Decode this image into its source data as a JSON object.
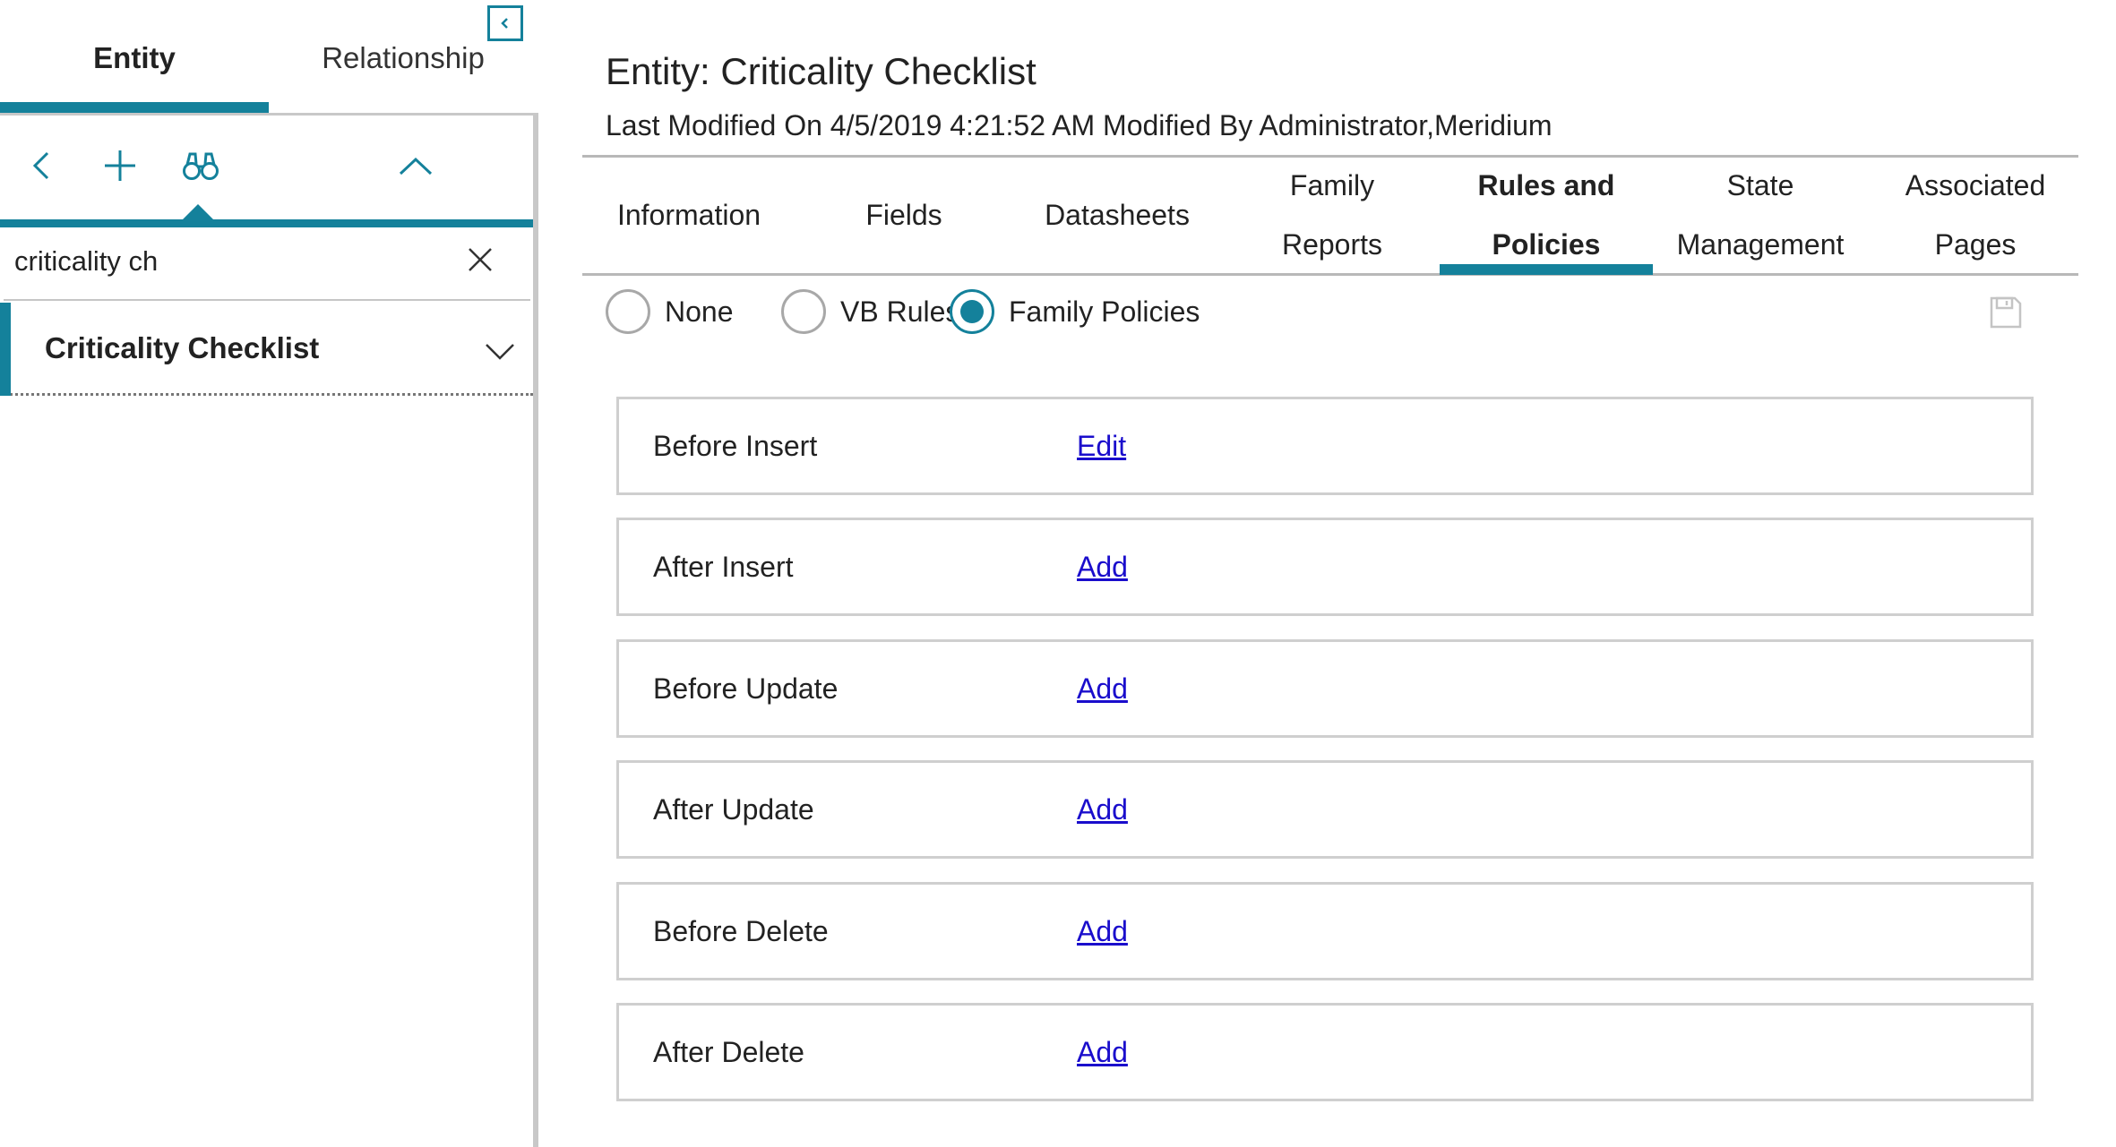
{
  "sidebar": {
    "tabs": [
      {
        "label": "Entity",
        "active": true
      },
      {
        "label": "Relationship",
        "active": false
      }
    ],
    "toolbar_icons": [
      "back-icon",
      "add-icon",
      "binoculars-icon",
      "chevron-up-icon"
    ],
    "search": {
      "value": "criticality ch"
    },
    "results": [
      {
        "label": "Criticality Checklist"
      }
    ]
  },
  "header": {
    "title": "Entity: Criticality Checklist",
    "subtitle": "Last Modified On 4/5/2019 4:21:52 AM Modified By Administrator,Meridium"
  },
  "main": {
    "tabs": [
      {
        "line1": "Information",
        "line2": ""
      },
      {
        "line1": "Fields",
        "line2": ""
      },
      {
        "line1": "Datasheets",
        "line2": ""
      },
      {
        "line1": "Family",
        "line2": "Reports"
      },
      {
        "line1": "Rules and",
        "line2": "Policies"
      },
      {
        "line1": "State",
        "line2": "Management"
      },
      {
        "line1": "Associated",
        "line2": "Pages"
      }
    ],
    "active_tab_index": 4,
    "radio_options": [
      {
        "label": "None",
        "checked": false
      },
      {
        "label": "VB Rules",
        "checked": false
      },
      {
        "label": "Family Policies",
        "checked": true
      }
    ],
    "policies": [
      {
        "event": "Before Insert",
        "action": "Edit"
      },
      {
        "event": "After Insert",
        "action": "Add"
      },
      {
        "event": "Before Update",
        "action": "Add"
      },
      {
        "event": "After Update",
        "action": "Add"
      },
      {
        "event": "Before Delete",
        "action": "Add"
      },
      {
        "event": "After Delete",
        "action": "Add"
      }
    ]
  },
  "colors": {
    "accent": "#14819b",
    "link": "#1a0dcc",
    "border": "#cfcfcf"
  }
}
